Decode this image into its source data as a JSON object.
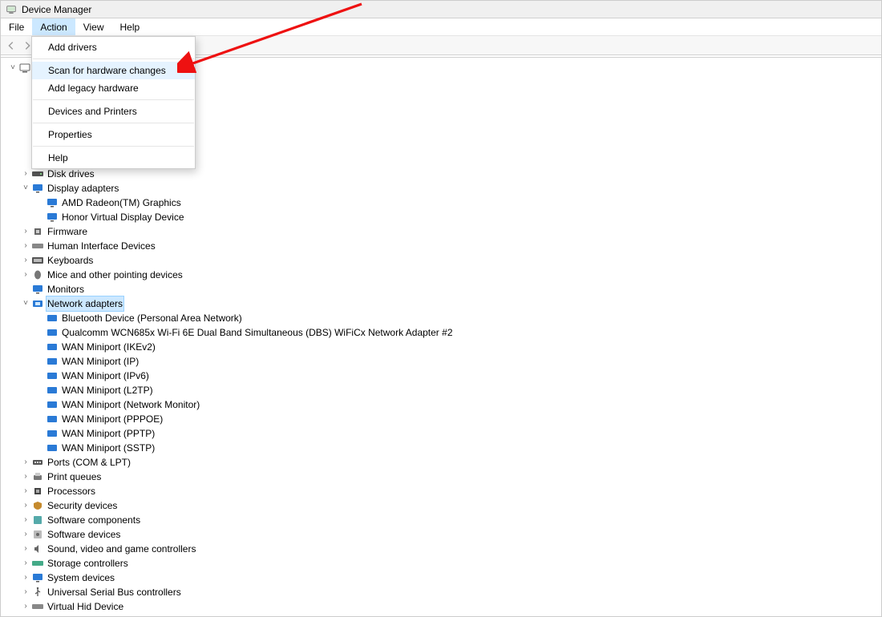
{
  "window": {
    "title": "Device Manager"
  },
  "menu_bar": {
    "file": "File",
    "action": "Action",
    "view": "View",
    "help": "Help"
  },
  "action_menu": {
    "add_drivers": "Add drivers",
    "scan": "Scan for hardware changes",
    "add_legacy": "Add legacy hardware",
    "devices_printers": "Devices and Printers",
    "properties": "Properties",
    "help": "Help"
  },
  "tree": {
    "root_visible": false,
    "items": {
      "disk_drives": "Disk drives",
      "display_adapters": "Display adapters",
      "amd_radeon": "AMD Radeon(TM) Graphics",
      "honor_virtual": "Honor Virtual Display Device",
      "firmware": "Firmware",
      "hid": "Human Interface Devices",
      "keyboards": "Keyboards",
      "mice": "Mice and other pointing devices",
      "monitors": "Monitors",
      "net_adapters": "Network adapters",
      "bt_pan": "Bluetooth Device (Personal Area Network)",
      "qualcomm": "Qualcomm WCN685x Wi-Fi 6E Dual Band Simultaneous (DBS) WiFiCx Network Adapter #2",
      "wan_ikev2": "WAN Miniport (IKEv2)",
      "wan_ip": "WAN Miniport (IP)",
      "wan_ipv6": "WAN Miniport (IPv6)",
      "wan_l2tp": "WAN Miniport (L2TP)",
      "wan_netmon": "WAN Miniport (Network Monitor)",
      "wan_pppoe": "WAN Miniport (PPPOE)",
      "wan_pptp": "WAN Miniport (PPTP)",
      "wan_sstp": "WAN Miniport (SSTP)",
      "ports": "Ports (COM & LPT)",
      "print_queues": "Print queues",
      "processors": "Processors",
      "security": "Security devices",
      "sw_components": "Software components",
      "sw_devices": "Software devices",
      "sound": "Sound, video and game controllers",
      "storage": "Storage controllers",
      "system": "System devices",
      "usb": "Universal Serial Bus controllers",
      "vhid": "Virtual Hid Device"
    }
  }
}
